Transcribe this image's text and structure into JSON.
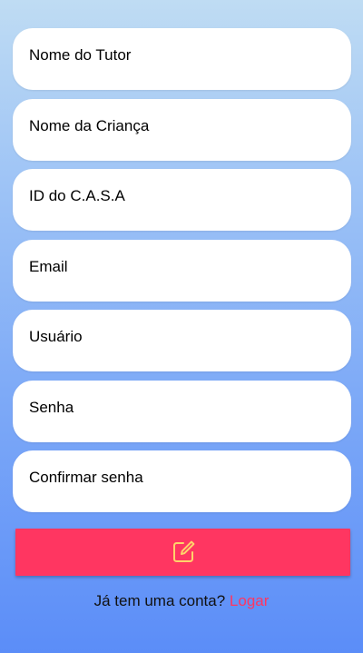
{
  "form": {
    "fields": [
      {
        "placeholder": "Nome do Tutor"
      },
      {
        "placeholder": "Nome da Criança"
      },
      {
        "placeholder": "ID do C.A.S.A"
      },
      {
        "placeholder": "Email"
      },
      {
        "placeholder": "Usuário"
      },
      {
        "placeholder": "Senha"
      },
      {
        "placeholder": "Confirmar senha"
      }
    ],
    "submit_icon": "edit-icon"
  },
  "footer": {
    "prompt": "Já tem uma conta?",
    "link_label": "Logar"
  },
  "colors": {
    "accent": "#ff3661",
    "icon": "#ffd36b",
    "field_bg": "#ffffff"
  }
}
